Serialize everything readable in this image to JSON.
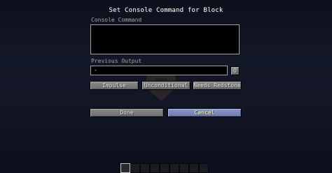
{
  "title": "Set Console Command for Block",
  "command_label": "Console Command",
  "command_value": "",
  "output_label": "Previous Output",
  "output_value": "-",
  "toggle_output_button": "O",
  "mode_button": "Impulse",
  "condition_button": "Unconditional",
  "redstone_button": "Needs Redstone",
  "done_button": "Done",
  "cancel_button": "Cancel",
  "hotbar": {
    "slots": 9,
    "selected_slot": 0
  },
  "colors": {
    "button_hover": "#7a86bc",
    "button_text_hover": "#ffffa0",
    "field_background": "#000000"
  }
}
